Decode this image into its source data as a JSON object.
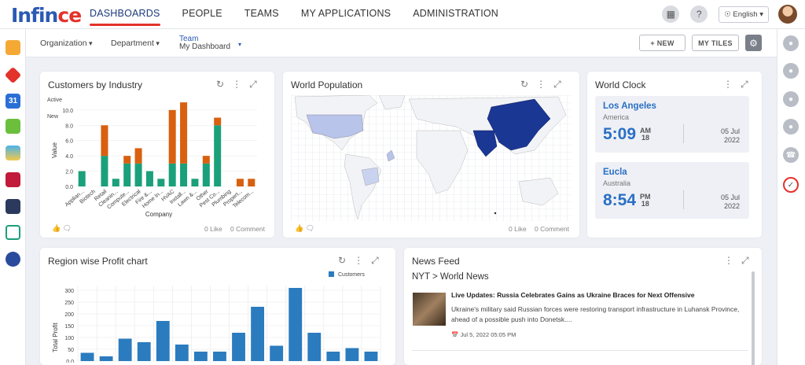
{
  "brand": {
    "logo_main": "Inf",
    "logo_mid": "in",
    "logo_c": "c",
    "logo_e": "e"
  },
  "nav": {
    "items": [
      "DASHBOARDS",
      "PEOPLE",
      "TEAMS",
      "MY APPLICATIONS",
      "ADMINISTRATION"
    ],
    "active": "DASHBOARDS"
  },
  "topright": {
    "language": "English"
  },
  "filters": {
    "organization": "Organization",
    "department": "Department",
    "team_label": "Team",
    "team_value": "My Dashboard"
  },
  "toolbar": {
    "new_label": "+ NEW",
    "my_tiles_label": "MY TILES"
  },
  "customers_chart": {
    "title": "Customers by Industry",
    "legend_cut": [
      "Active",
      "New"
    ],
    "chart_data": {
      "type": "bar",
      "stacked": true,
      "title": "Customers by Industry",
      "xlabel": "Company",
      "ylabel": "Value",
      "ylim": [
        0,
        10.5
      ],
      "yticks": [
        "0.0",
        "2.0",
        "4.0",
        "6.0",
        "8.0",
        "10.0"
      ],
      "categories": [
        "Appliances",
        "Biotech",
        "Retail",
        "Cleanin...",
        "Compute...",
        "Electrical",
        "Fire &...",
        "Home In...",
        "HVAC",
        "Install...",
        "Lawn &...",
        "Other",
        "Pest Co...",
        "Plumbing",
        "Propert...",
        "Telecom..."
      ],
      "category_labels": [
        "Applian...",
        "Biotech",
        "Retail",
        "Cleanin...",
        "Compute...",
        "Electrical",
        "Fire &...",
        "Home In...",
        "HVAC",
        "Install...",
        "Lawn &...",
        "Other",
        "Pest Co...",
        "Plumbing",
        "Propert...",
        "Telecom..."
      ],
      "series": [
        {
          "name": "Active",
          "color": "#1aa07a",
          "values": [
            2,
            0,
            4,
            1,
            3,
            3,
            2,
            1,
            3,
            3,
            1,
            3,
            8,
            0,
            0,
            0
          ]
        },
        {
          "name": "New",
          "color": "#d8600f",
          "values": [
            0,
            0,
            4,
            0,
            1,
            2,
            0,
            0,
            7,
            8,
            0,
            1,
            1,
            0,
            1,
            1
          ]
        }
      ]
    },
    "likes": "0 Like",
    "comments": "0 Comment"
  },
  "world_population": {
    "title": "World Population",
    "likes": "0 Like",
    "comments": "0 Comment"
  },
  "world_clock": {
    "title": "World Clock",
    "clocks": [
      {
        "city": "Los Angeles",
        "region": "America",
        "time": "5:09",
        "ampm": "AM",
        "hour24": "18",
        "date1": "05 Jul",
        "date2": "2022"
      },
      {
        "city": "Eucla",
        "region": "Australia",
        "time": "8:54",
        "ampm": "PM",
        "hour24": "18",
        "date1": "05 Jul",
        "date2": "2022"
      }
    ]
  },
  "region_chart": {
    "title": "Region wise Profit chart",
    "chart_data": {
      "type": "bar",
      "ylabel": "Total Profit",
      "ylim": [
        0,
        320
      ],
      "yticks": [
        "0.0",
        "50",
        "100",
        "150",
        "200",
        "250",
        "300"
      ],
      "series": [
        {
          "name": "Customers",
          "color": "#2b7bbf",
          "values": [
            35,
            20,
            95,
            80,
            170,
            70,
            40,
            40,
            120,
            230,
            65,
            310,
            120,
            40,
            55,
            40
          ]
        }
      ]
    }
  },
  "news_feed": {
    "title": "News Feed",
    "source": "NYT > World News",
    "headline": "Live Updates: Russia Celebrates Gains as Ukraine Braces for Next Offensive",
    "body": "Ukraine's military said Russian forces were restoring transport infrastructure in Luhansk Province, ahead of a possible push into Donetsk....",
    "time": "Jul 5, 2022 05:05 PM"
  },
  "colors": {
    "accent": "#2a5ab3",
    "brand_red": "#e3322b",
    "active": "#1aa07a",
    "new": "#d8600f",
    "map_highlight": "#1b3794",
    "map_light": "#b8c4ea",
    "clock_blue": "#2a6fc4"
  }
}
